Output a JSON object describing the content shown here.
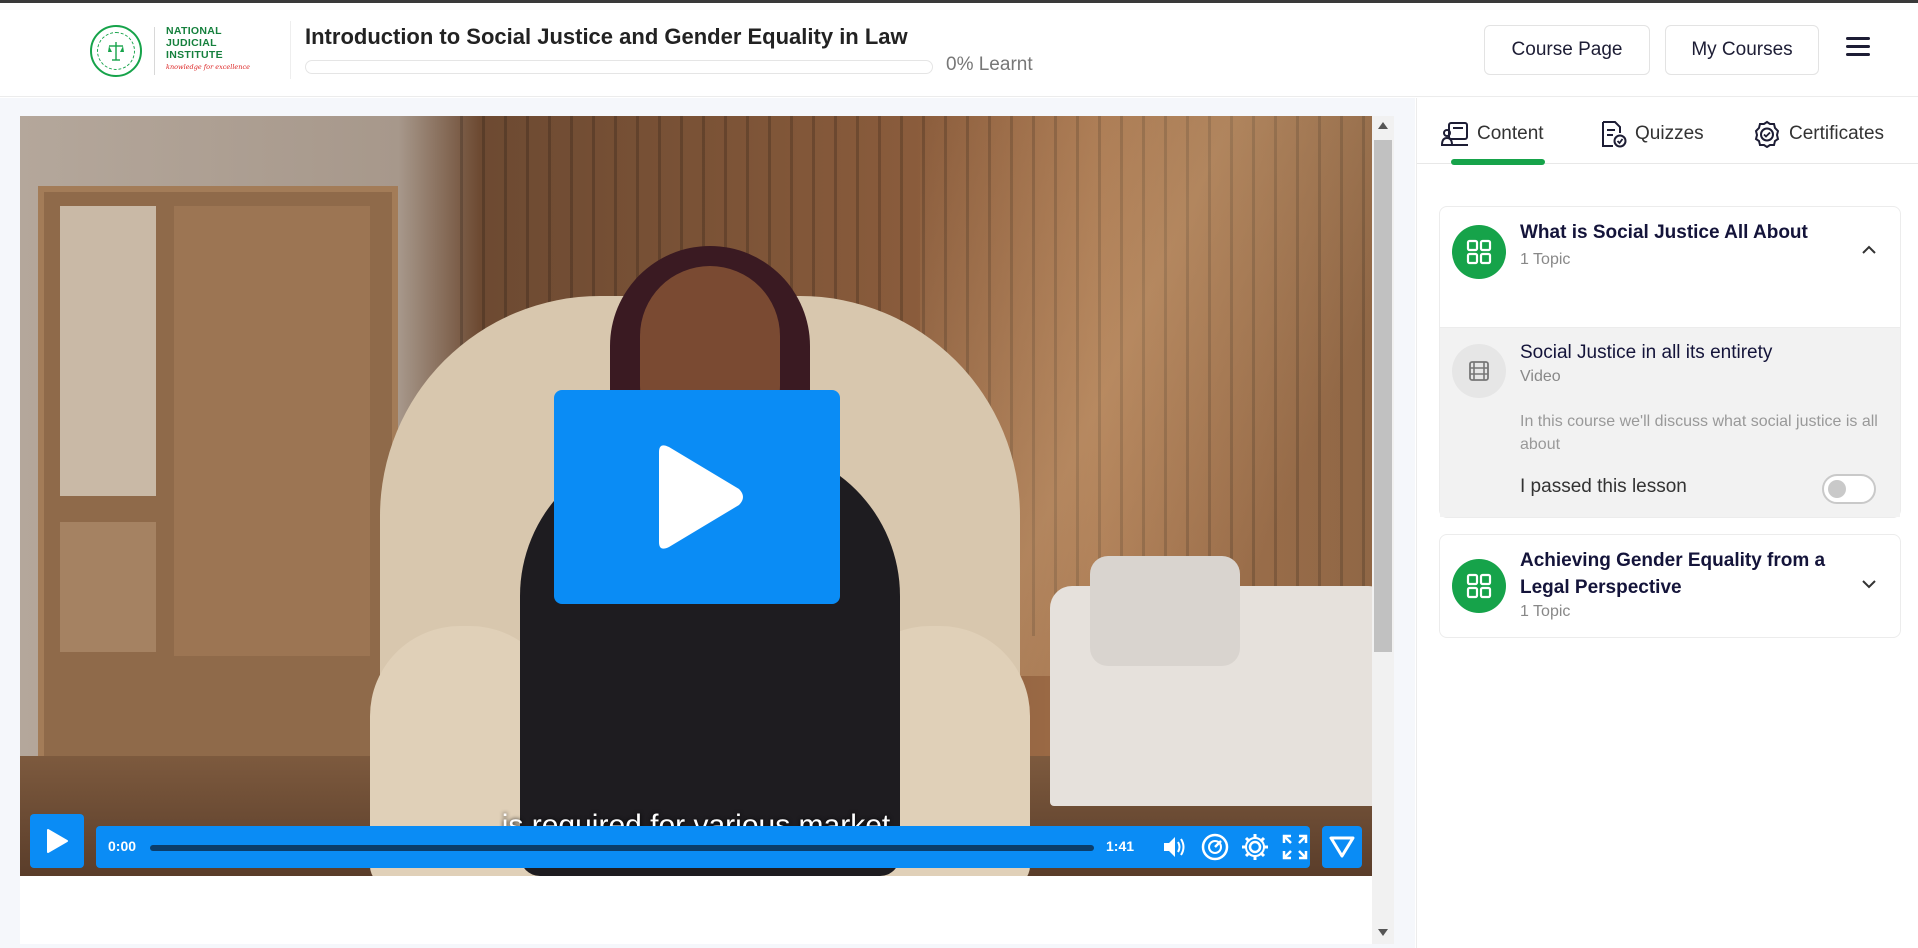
{
  "header": {
    "logo": {
      "line1": "NATIONAL",
      "line2": "JUDICIAL",
      "line3": "INSTITUTE",
      "tagline": "knowledge for excellence"
    },
    "course_title": "Introduction to Social Justice and Gender Equality in Law",
    "progress_percent": 0,
    "progress_label": "0% Learnt",
    "course_page_label": "Course Page",
    "my_courses_label": "My Courses",
    "menu_icon": "hamburger-menu-icon"
  },
  "video": {
    "subtitle": "is required for various market",
    "current_time": "0:00",
    "total_time": "1:41",
    "progress_fraction": 0,
    "accent_color": "#0a8cf5",
    "controls": [
      "play-icon",
      "volume-icon",
      "speed-icon",
      "settings-icon",
      "fullscreen-icon",
      "vimeo-icon"
    ]
  },
  "sidebar": {
    "tabs": [
      {
        "label": "Content",
        "icon": "content-icon",
        "active": true
      },
      {
        "label": "Quizzes",
        "icon": "quiz-icon",
        "active": false
      },
      {
        "label": "Certificates",
        "icon": "certificate-icon",
        "active": false
      }
    ],
    "accent_color": "#16a34a",
    "modules": [
      {
        "title": "What is Social Justice All About",
        "topics": "1 Topic",
        "expanded": true,
        "lessons": [
          {
            "title": "Social Justice in all its entirety",
            "type": "Video",
            "description": "In this course we'll discuss what social justice is all about",
            "passed_label": "I passed this lesson",
            "passed": false
          }
        ]
      },
      {
        "title": "Achieving Gender Equality from a Legal Perspective",
        "topics": "1 Topic",
        "expanded": false
      }
    ]
  }
}
